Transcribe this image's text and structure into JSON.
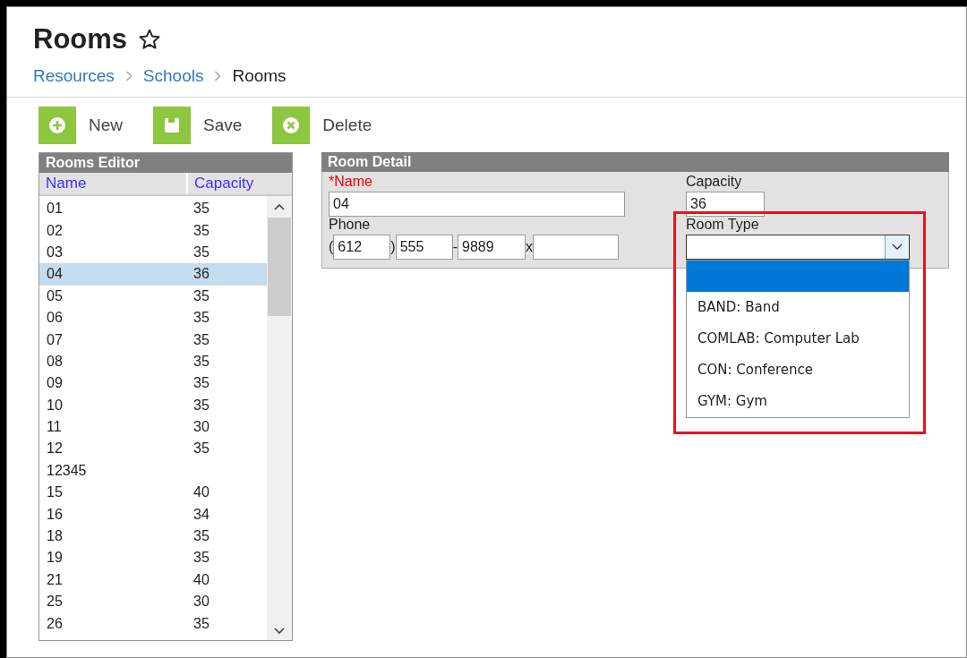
{
  "page": {
    "title": "Rooms",
    "favorite": false
  },
  "breadcrumb": [
    {
      "label": "Resources",
      "link": true
    },
    {
      "label": "Schools",
      "link": true
    },
    {
      "label": "Rooms",
      "link": false
    }
  ],
  "toolbar": [
    {
      "kind": "new",
      "label": "New"
    },
    {
      "kind": "save",
      "label": "Save"
    },
    {
      "kind": "delete",
      "label": "Delete"
    }
  ],
  "rooms_editor": {
    "title": "Rooms Editor",
    "columns": [
      "Name",
      "Capacity"
    ],
    "rows": [
      {
        "name": "01",
        "capacity": "35",
        "selected": false
      },
      {
        "name": "02",
        "capacity": "35",
        "selected": false
      },
      {
        "name": "03",
        "capacity": "35",
        "selected": false
      },
      {
        "name": "04",
        "capacity": "36",
        "selected": true
      },
      {
        "name": "05",
        "capacity": "35",
        "selected": false
      },
      {
        "name": "06",
        "capacity": "35",
        "selected": false
      },
      {
        "name": "07",
        "capacity": "35",
        "selected": false
      },
      {
        "name": "08",
        "capacity": "35",
        "selected": false
      },
      {
        "name": "09",
        "capacity": "35",
        "selected": false
      },
      {
        "name": "10",
        "capacity": "35",
        "selected": false
      },
      {
        "name": "11",
        "capacity": "30",
        "selected": false
      },
      {
        "name": "12",
        "capacity": "35",
        "selected": false
      },
      {
        "name": "12345",
        "selected": false
      },
      {
        "name": "15",
        "capacity": "40",
        "selected": false
      },
      {
        "name": "16",
        "capacity": "34",
        "selected": false
      },
      {
        "name": "18",
        "capacity": "35",
        "selected": false
      },
      {
        "name": "19",
        "capacity": "35",
        "selected": false
      },
      {
        "name": "21",
        "capacity": "40",
        "selected": false
      },
      {
        "name": "25",
        "capacity": "30",
        "selected": false
      },
      {
        "name": "26",
        "capacity": "35",
        "selected": false
      }
    ]
  },
  "room_detail": {
    "title": "Room Detail",
    "name_label": "*Name",
    "name_value": "04",
    "capacity_label": "Capacity",
    "capacity_value": "36",
    "phone_label": "Phone",
    "phone_open": "(",
    "phone_area": "612",
    "phone_close": ")",
    "phone_prefix": "555",
    "phone_dash": "-",
    "phone_line": "9889",
    "phone_ext_label": "x",
    "room_type_label": "Room Type",
    "room_type_options": [
      {
        "selected": true
      },
      {
        "label": "BAND: Band",
        "selected": false
      },
      {
        "label": "COMLAB: Computer Lab",
        "selected": false
      },
      {
        "label": "CON: Conference",
        "selected": false
      },
      {
        "label": "GYM: Gym",
        "selected": false
      }
    ]
  }
}
